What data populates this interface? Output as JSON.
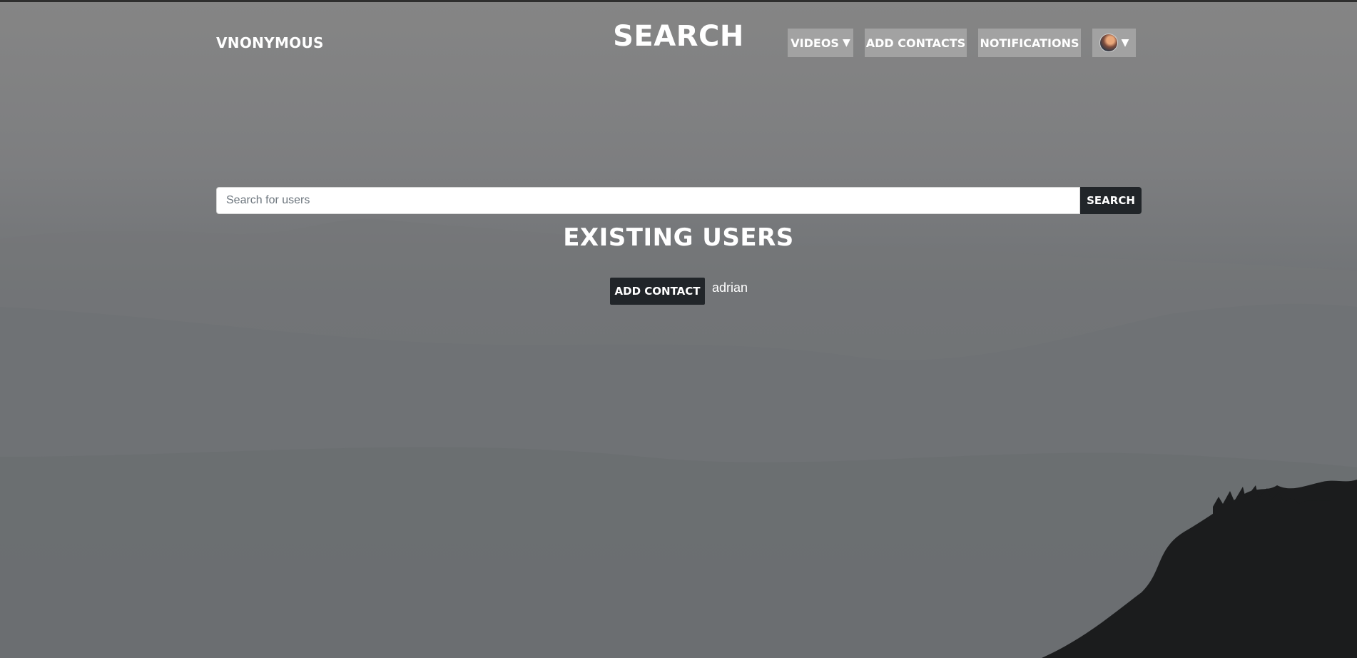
{
  "header": {
    "brand": "VNONYMOUS",
    "title": "SEARCH"
  },
  "nav": {
    "videos_label": "VIDEOS",
    "videos_caret": "▼",
    "add_contacts_label": "ADD CONTACTS",
    "notifications_label": "NOTIFICATIONS",
    "profile_caret": "▼"
  },
  "search": {
    "placeholder": "Search for users",
    "value": "",
    "button_label": "SEARCH"
  },
  "users_section": {
    "title": "EXISTING USERS",
    "users": [
      {
        "add_label": "ADD CONTACT",
        "username": "adrian"
      }
    ]
  },
  "colors": {
    "nav_button_bg": "#a2a2a2",
    "dark_button_bg": "#212529",
    "text": "#ffffff"
  },
  "icons": {
    "avatar": "avatar-photo",
    "caret": "chevron-down-icon"
  }
}
